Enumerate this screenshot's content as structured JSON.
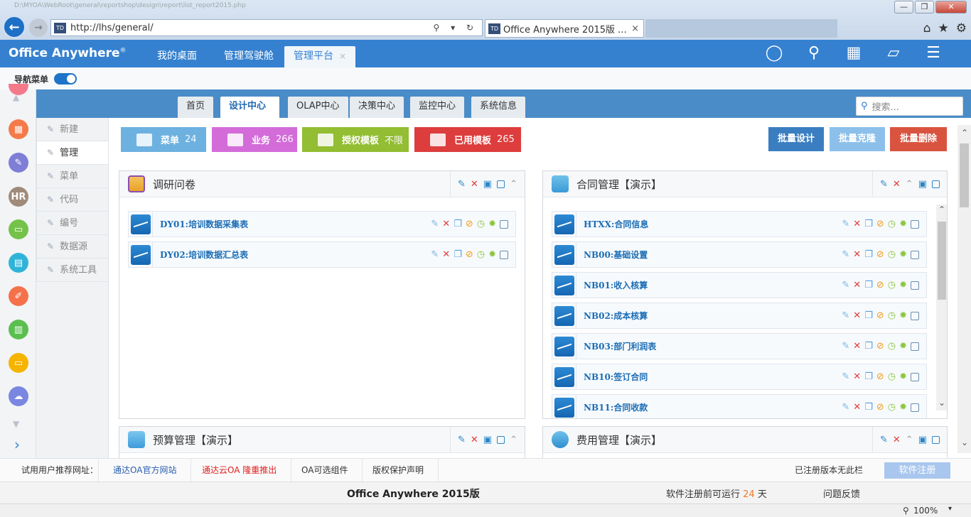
{
  "browser": {
    "faint_url": "D:\\MYOA\\WebRoot\\general\\reportshop\\design\\report\\list_report2015.php",
    "address": "http://lhs/general/",
    "tab_title": "Office Anywhere 2015版 ...",
    "tab_close": "×",
    "site_icon": "TD",
    "addr_controls": "⚲ ▾ ↻",
    "window_buttons": [
      "—",
      "❐",
      "✕"
    ],
    "toolbar_icons": [
      "⌂",
      "★",
      "⚙"
    ]
  },
  "app": {
    "brand": "Office Anywhere",
    "brand_mark": "®",
    "tabs": [
      {
        "label": "我的桌面"
      },
      {
        "label": "管理驾驶舱"
      },
      {
        "label": "管理平台",
        "close": "×"
      }
    ],
    "header_icons": [
      "user-icon",
      "search-icon",
      "apps-icon",
      "theme-shirt-icon",
      "menu-icon"
    ]
  },
  "subbar": {
    "nav_toggle_label": "导航菜单"
  },
  "rail": {
    "icons": [
      {
        "name": "report-icon",
        "color": "#f47a4a"
      },
      {
        "name": "document-icon",
        "color": "#7e7ed6"
      },
      {
        "name": "hr-icon",
        "color": "#a08b7a",
        "text": "HR"
      },
      {
        "name": "case-icon",
        "color": "#74c24a"
      },
      {
        "name": "inbox-icon",
        "color": "#2fb4d8"
      },
      {
        "name": "note-icon",
        "color": "#f4714a"
      },
      {
        "name": "stats-icon",
        "color": "#5bbf4f"
      },
      {
        "name": "screen-icon",
        "color": "#f5b400"
      },
      {
        "name": "cloud-icon",
        "color": "#7a86e0"
      }
    ],
    "expand": "›"
  },
  "topnav": {
    "items": [
      "首页",
      "设计中心",
      "OLAP中心",
      "决策中心",
      "监控中心",
      "系统信息"
    ],
    "active": "设计中心",
    "search_placeholder": "搜索..."
  },
  "sidemenu": {
    "items": [
      "新建",
      "管理",
      "菜单",
      "代码",
      "编号",
      "数据源",
      "系统工具"
    ],
    "active": "管理"
  },
  "stats": [
    {
      "label": "菜单",
      "count": "24",
      "color": "#6cb1e0"
    },
    {
      "label": "业务",
      "count": "266",
      "color": "#d36cd9"
    },
    {
      "label": "授权模板",
      "count": "不限",
      "color": "#93bd32"
    },
    {
      "label": "已用模板",
      "count": "265",
      "color": "#dd3d3d"
    }
  ],
  "actions": [
    {
      "label": "批量设计",
      "color": "#3a7ec1"
    },
    {
      "label": "批量克隆",
      "color": "#8cc0ea"
    },
    {
      "label": "批量删除",
      "color": "#d9543f"
    }
  ],
  "panels": {
    "survey": {
      "title": "调研问卷",
      "rows": [
        "DY01:培训数据采集表",
        "DY02:培训数据汇总表"
      ]
    },
    "contract": {
      "title": "合同管理【演示】",
      "rows": [
        "HTXX:合同信息",
        "NB00:基础设置",
        "NB01:收入核算",
        "NB02:成本核算",
        "NB03:部门利润表",
        "NB10:签订合同",
        "NB11:合同收款"
      ]
    },
    "budget": {
      "title": "预算管理【演示】"
    },
    "expense": {
      "title": "费用管理【演示】"
    }
  },
  "footer": {
    "recommend_label": "试用用户推荐网址：",
    "links": [
      "通达OA官方网站",
      "通达云OA 隆重推出",
      "OA可选组件",
      "版权保护声明"
    ],
    "no_ad": "已注册版本无此栏",
    "register": "软件注册",
    "product": "Office Anywhere 2015版",
    "trial_prefix": "软件注册前可运行",
    "trial_days": "24",
    "trial_suffix": "天",
    "feedback": "问题反馈"
  },
  "status": {
    "zoom": "100%"
  }
}
